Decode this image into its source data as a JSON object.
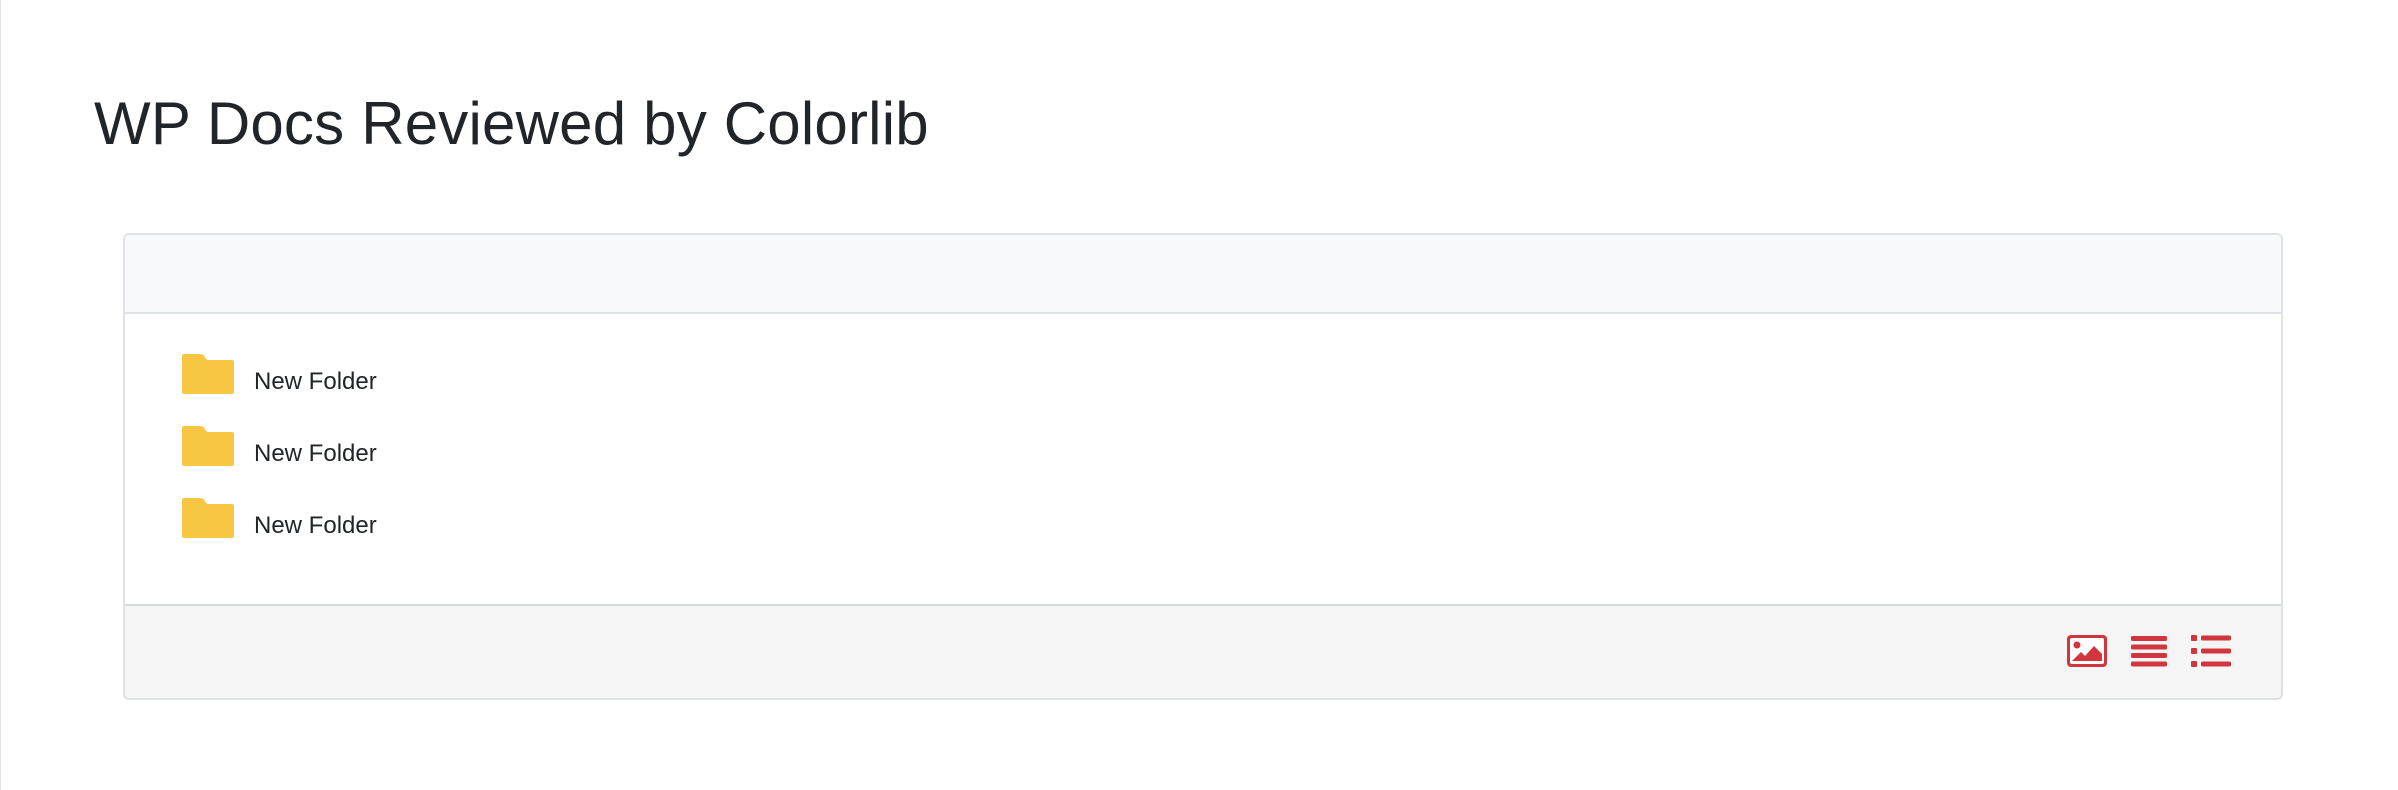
{
  "page": {
    "title": "WP Docs Reviewed by Colorlib"
  },
  "folders": [
    {
      "label": "New Folder",
      "icon": "folder-icon"
    },
    {
      "label": "New Folder",
      "icon": "folder-icon"
    },
    {
      "label": "New Folder",
      "icon": "folder-icon"
    }
  ],
  "footer": {
    "view_buttons": [
      {
        "icon": "image-icon"
      },
      {
        "icon": "list-lines-icon"
      },
      {
        "icon": "bulleted-list-icon"
      }
    ]
  },
  "colors": {
    "folder": "#f7c744",
    "accent": "#d1363f",
    "header_bg": "#f8f9fa",
    "footer_bg": "#f5f5f5",
    "border": "#dee2e6"
  }
}
